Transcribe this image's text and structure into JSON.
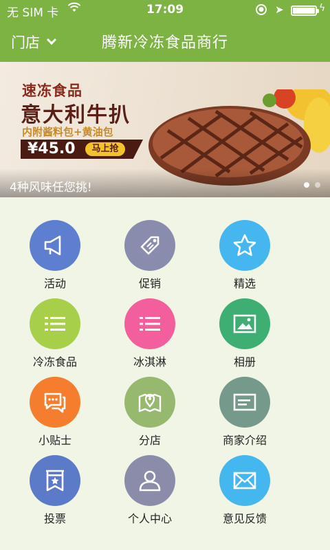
{
  "status": {
    "carrier": "无 SIM 卡",
    "time": "17:09",
    "icons": [
      "wifi-icon",
      "rotation-lock-icon",
      "location-icon",
      "battery-icon",
      "charging-icon"
    ]
  },
  "nav": {
    "store_label": "门店",
    "title": "腾新冷冻食品商行"
  },
  "banner": {
    "line1": "速冻食品",
    "line2": "意大利牛扒",
    "line3": "内附酱料包+黄油包",
    "price": "¥45.0",
    "buy_label": "马上抢",
    "caption": "4种风味任您挑!",
    "page_count": 2,
    "active_page": 1
  },
  "grid": {
    "items": [
      {
        "label": "活动",
        "icon": "megaphone-icon",
        "color": "#5e7fd0"
      },
      {
        "label": "促销",
        "icon": "tag-icon",
        "color": "#8a8cae"
      },
      {
        "label": "精选",
        "icon": "star-icon",
        "color": "#45b6ef"
      },
      {
        "label": "冷冻食品",
        "icon": "list-icon",
        "color": "#a8cf4a"
      },
      {
        "label": "冰淇淋",
        "icon": "list-icon",
        "color": "#f35e9c"
      },
      {
        "label": "相册",
        "icon": "picture-icon",
        "color": "#3fae72"
      },
      {
        "label": "小贴士",
        "icon": "chat-icon",
        "color": "#f57e2e"
      },
      {
        "label": "分店",
        "icon": "map-pin-icon",
        "color": "#97b86f"
      },
      {
        "label": "商家介绍",
        "icon": "card-icon",
        "color": "#75998a"
      },
      {
        "label": "投票",
        "icon": "vote-icon",
        "color": "#5b7ac8"
      },
      {
        "label": "个人中心",
        "icon": "person-icon",
        "color": "#8a8caa"
      },
      {
        "label": "意见反馈",
        "icon": "mail-icon",
        "color": "#43b7ee"
      }
    ]
  }
}
